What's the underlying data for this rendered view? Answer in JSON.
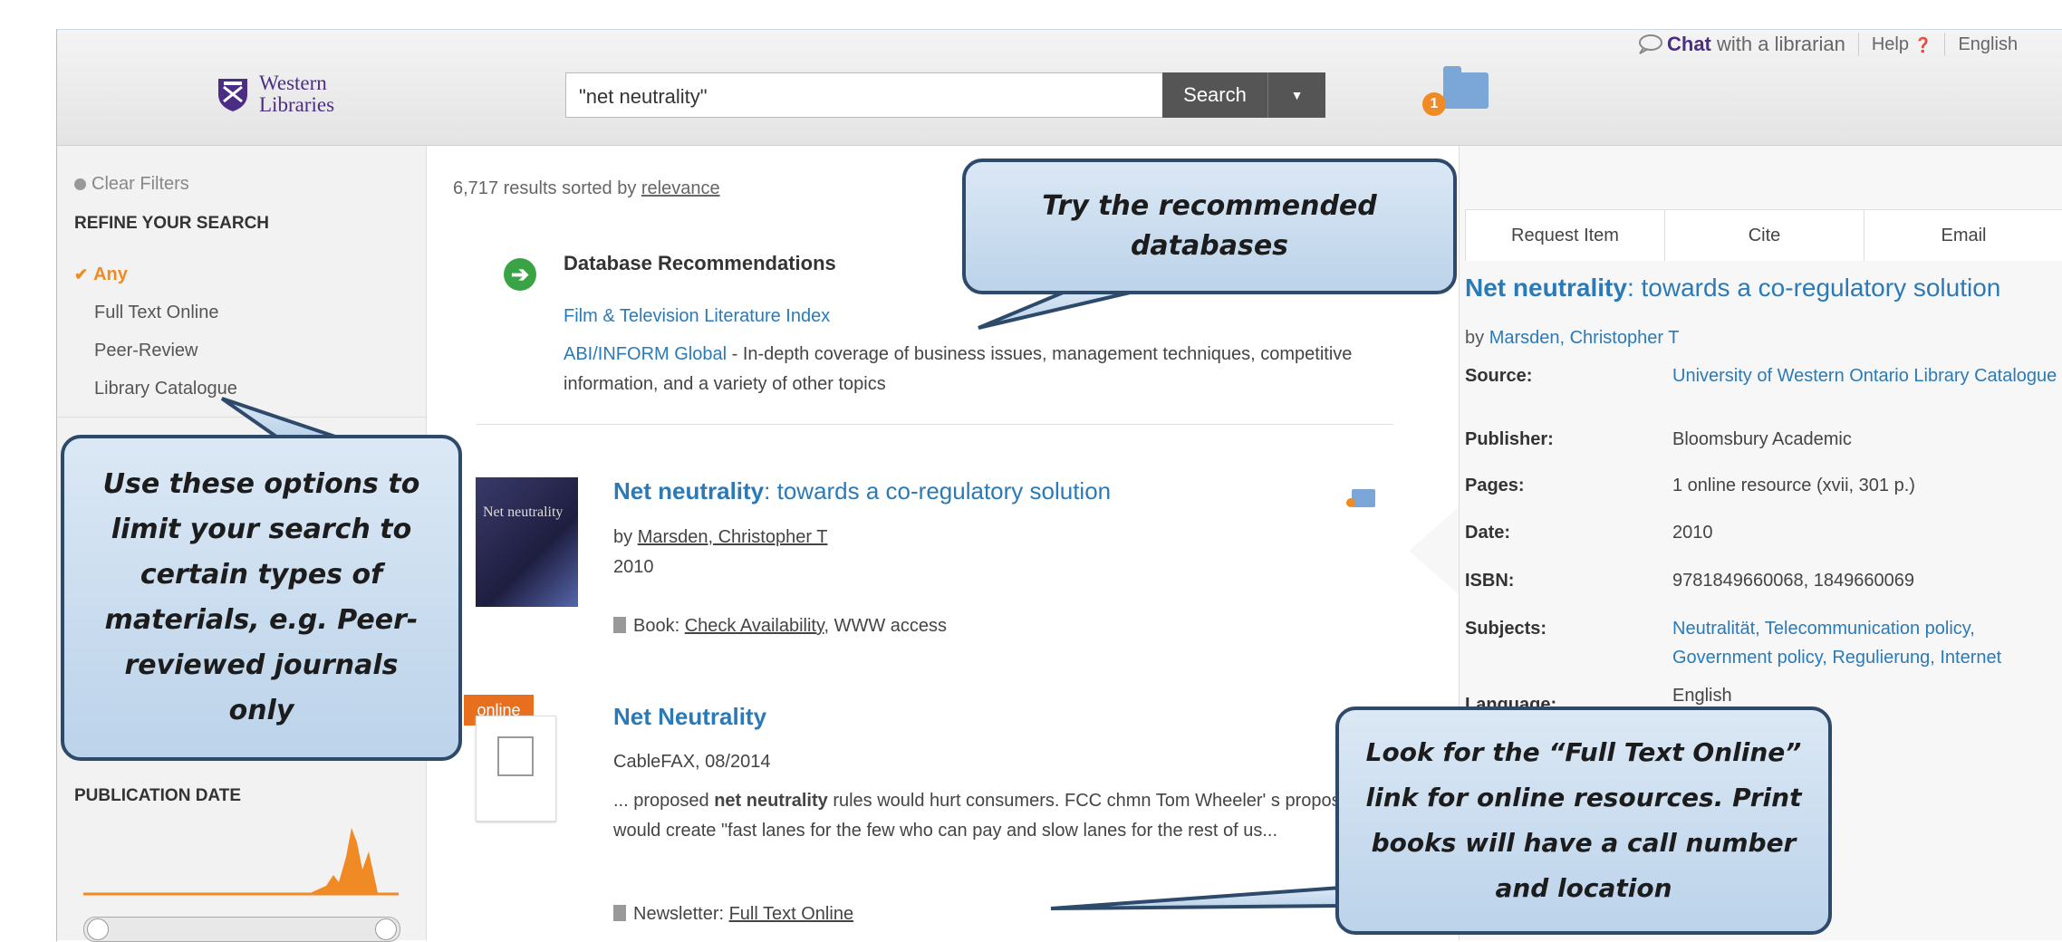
{
  "header": {
    "logo_line1": "Western",
    "logo_line2": "Libraries",
    "search_value": "\"net neutrality\"",
    "search_button": "Search",
    "dropdown_caret": "▼",
    "folder_count": "1",
    "chat_bold": "Chat",
    "chat_rest": " with a librarian",
    "help": "Help",
    "help_icon": "❓",
    "language": "English"
  },
  "sidebar": {
    "clear_filters": "Clear Filters",
    "refine_heading": "REFINE YOUR SEARCH",
    "facets": [
      "Any",
      "Full Text Online",
      "Peer-Review",
      "Library Catalogue"
    ],
    "publication_date": "PUBLICATION DATE"
  },
  "results": {
    "count_text": "6,717 results sorted by ",
    "sort_link": "relevance",
    "db_heading": "Database Recommendations",
    "db_links": [
      "Film & Television Literature Index",
      "ABI/INFORM Global"
    ],
    "db_desc": " - In-depth coverage of business issues, management techniques, competitive information, and a variety of other topics",
    "items": [
      {
        "title_bold": "Net neutrality",
        "title_rest": ": towards a co-regulatory solution",
        "by_prefix": "by ",
        "author": "Marsden, Christopher T",
        "year": "2010",
        "type_prefix": "Book: ",
        "check_link": "Check Availability",
        "access": ", WWW access",
        "thumb_text": "Net neutrality"
      },
      {
        "online_tag": "online",
        "title": "Net Neutrality",
        "source": "CableFAX, 08/2014",
        "snippet_1": "... proposed ",
        "snippet_bold": "net neutrality",
        "snippet_2": " rules would hurt consumers. FCC chmn Tom Wheeler' s proposal would create \"fast lanes for the few who can pay and slow lanes for the rest of us...",
        "type_prefix": "Newsletter: ",
        "fulltext_link": "Full Text Online"
      }
    ]
  },
  "detail": {
    "tabs": [
      "Request Item",
      "Cite",
      "Email"
    ],
    "title_bold": "Net neutrality",
    "title_rest": ": towards a co-regulatory solution",
    "by_prefix": "by ",
    "author": "Marsden, Christopher T",
    "fields": [
      {
        "label": "Source:",
        "value": "University of Western Ontario Library Catalogue",
        "link": true
      },
      {
        "label": "Publisher:",
        "value": "Bloomsbury Academic",
        "link": false
      },
      {
        "label": "Pages:",
        "value": "1 online resource (xvii, 301 p.)",
        "link": false
      },
      {
        "label": "Date:",
        "value": "2010",
        "link": false
      },
      {
        "label": "ISBN:",
        "value": "9781849660068, 1849660069",
        "link": false
      },
      {
        "label": "Subjects:",
        "value": "Neutralität, Telecommunication policy, Government policy, Regulierung, Internet",
        "link": true
      },
      {
        "label": "Language:",
        "value": "English",
        "link": false
      }
    ]
  },
  "callouts": {
    "databases": "Try the recommended databases",
    "options": "Use these options to limit your search to certain types of materials, e.g. Peer-reviewed journals only",
    "fulltext": "Look for the “Full Text Online” link for online resources. Print books will have a call number and location"
  },
  "colors": {
    "accent_blue": "#2b7ab8",
    "orange": "#f08a24",
    "purple": "#4b2e83",
    "callout_border": "#2e4a6b"
  }
}
